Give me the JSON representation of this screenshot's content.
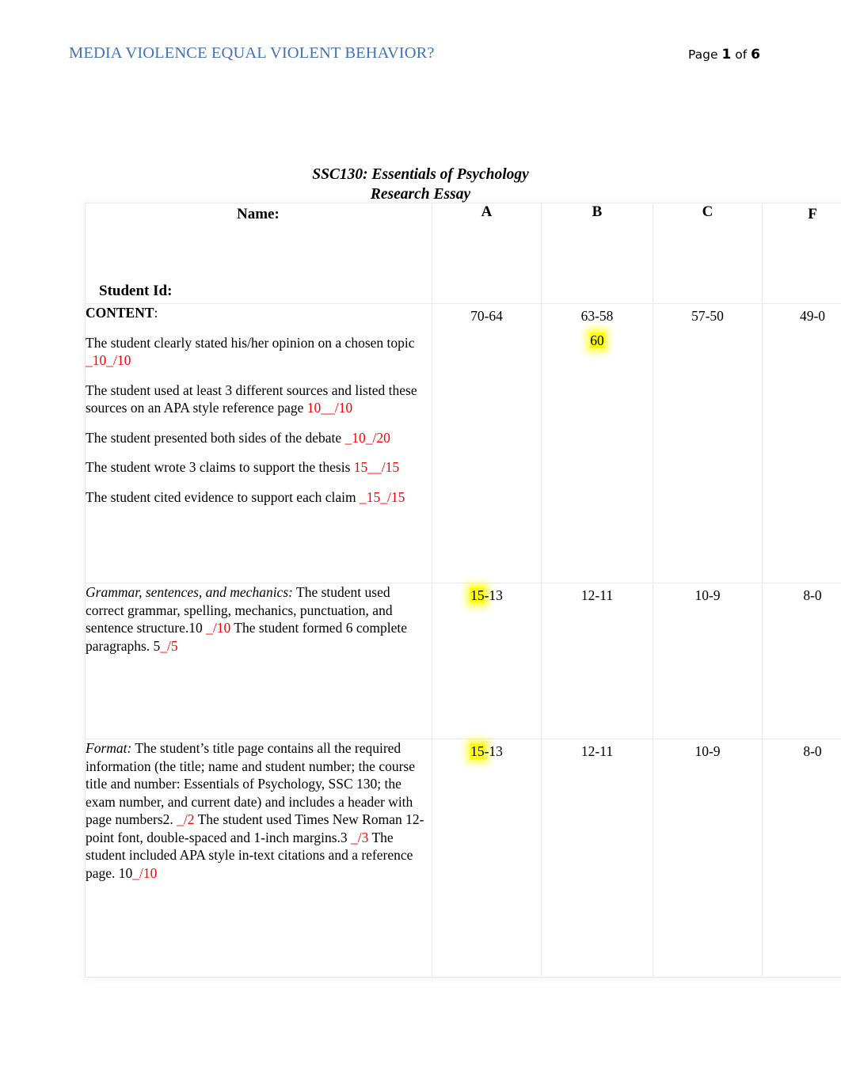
{
  "header": {
    "running_title": "MEDIA VIOLENCE EQUAL VIOLENT BEHAVIOR?",
    "page_word": "Page",
    "page_number": "1",
    "of_word": "of",
    "page_total": "6",
    "title_color": "#4472b4"
  },
  "document": {
    "title_line1": "SSC130: Essentials of Psychology",
    "title_line2": "Research Essay"
  },
  "table": {
    "name_label": "Name:",
    "student_id_label": "Student Id:",
    "grade_columns": [
      "A",
      "B",
      "C",
      "F"
    ],
    "rows": [
      {
        "id": "content",
        "heading": "CONTENT",
        "heading_suffix": ":",
        "criteria": [
          {
            "text": "The student clearly stated his/her opinion on a chosen topic ",
            "score": "_10_/10"
          },
          {
            "text": "The student used at least 3 different sources and listed these sources on an APA style reference page ",
            "score": "10__/10"
          },
          {
            "text": "The student presented both sides of the debate ",
            "score": "_10_/20"
          },
          {
            "text": "The student wrote 3 claims to support the thesis ",
            "score": "15__/15"
          },
          {
            "text": "The student cited evidence to support each claim ",
            "score": "_15_/15"
          }
        ],
        "grade_a": "70-64",
        "grade_b_range": "63-58",
        "grade_b_awarded": "60",
        "grade_b_awarded_highlighted": true,
        "grade_c": "57-50",
        "grade_f": "49-0"
      },
      {
        "id": "grammar",
        "label": "Grammar, sentences, and mechanics:",
        "body_part1": " The student used correct grammar, spelling, mechanics, punctuation, and sentence structure.10 ",
        "score1": "_/10",
        "body_part2": " The student formed 6 complete paragraphs. 5",
        "score2": "_/5",
        "grade_a_highlighted": "15",
        "grade_a_rest": "-13",
        "grade_b": "12-11",
        "grade_c": "10-9",
        "grade_f": "8-0"
      },
      {
        "id": "format",
        "label": "Format:",
        "body_part1": " The student’s title page contains all the required information (the title; name and student number; the course title and number: Essentials of Psychology, SSC 130; the exam number, and current date) and includes a header with page numbers2. ",
        "score1": "_/2",
        "body_part2": " The student used Times New Roman 12-point font, double-spaced and 1-inch margins.3 ",
        "score2": "_/3",
        "body_part3": " The student included APA style in-text citations and a reference page. 10",
        "score3": "_/10",
        "grade_a_highlighted": "15",
        "grade_a_rest": "-13",
        "grade_b": "12-11",
        "grade_c": "10-9",
        "grade_f": "8-0"
      }
    ]
  },
  "colors": {
    "score_red": "#ff0000",
    "highlight_yellow": "#ffff00",
    "header_blue": "#4472b4"
  }
}
